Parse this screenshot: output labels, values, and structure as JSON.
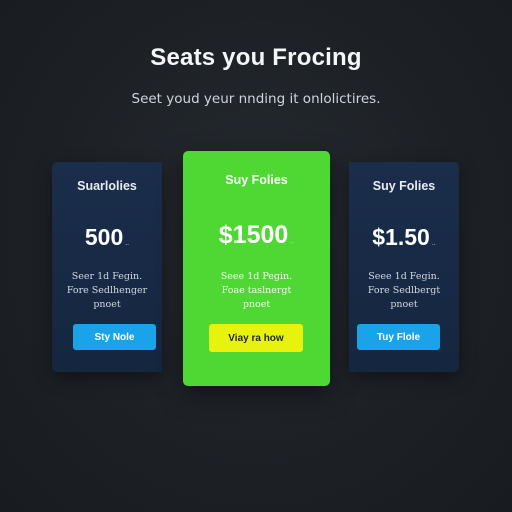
{
  "header": {
    "title": "Seats you Frocing",
    "subtitle": "Seet youd yeur nnding it onlolictires."
  },
  "plans": [
    {
      "name": "Suarlolies",
      "price": "500",
      "price_suffix": "..",
      "desc_line1": "Seer 1d Fegin.",
      "desc_line2": "Fore Sedlhenger",
      "desc_line3": "pnoet",
      "button_label": "Sty Nole"
    },
    {
      "name": "Suy Folies",
      "price": "$1500",
      "price_suffix": "..",
      "desc_line1": "Seee 1d Pegin.",
      "desc_line2": "Foae taslnergt",
      "desc_line3": "pnoet",
      "button_label": "Viay ra how"
    },
    {
      "name": "Suy Folies",
      "price": "$1.50",
      "price_suffix": "..",
      "desc_line1": "Seee 1d Fegin.",
      "desc_line2": "Fore Sedlbergt",
      "desc_line3": "pnoet",
      "button_label": "Tuy Flole"
    }
  ],
  "colors": {
    "background": "#1d2126",
    "side_card": "#1a2d4b",
    "featured_card": "#4fd833",
    "side_button": "#1aa3e8",
    "featured_button": "#e8f20f"
  }
}
